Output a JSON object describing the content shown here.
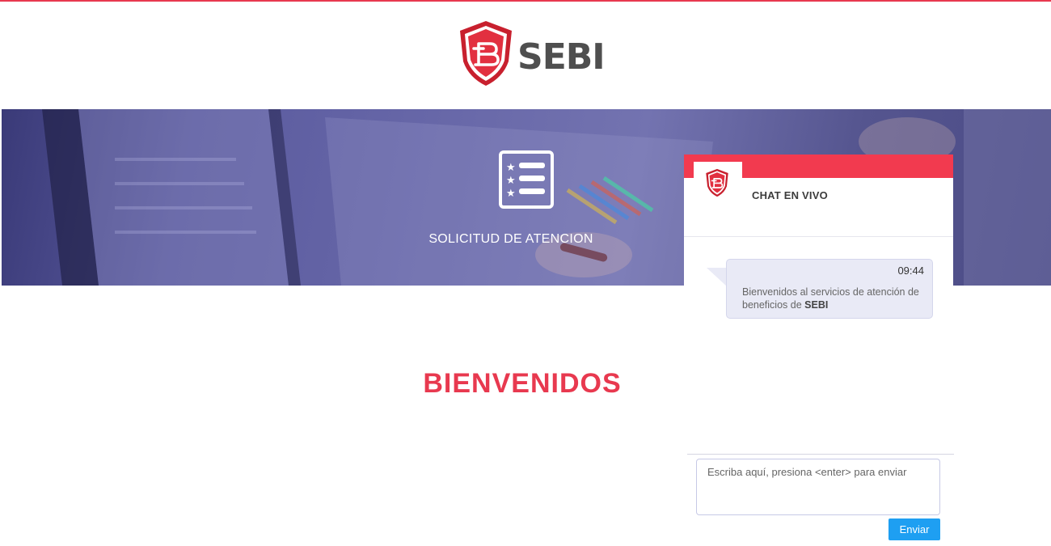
{
  "brand": {
    "name": "SEBI",
    "accent": "#e8394f"
  },
  "hero": {
    "title": "SOLICITUD DE ATENCION",
    "icon": "checklist-icon"
  },
  "main": {
    "title": "BIENVENIDOS"
  },
  "chat": {
    "title": "CHAT EN VIVO",
    "message": {
      "time": "09:44",
      "text": "Bienvenidos al servicios de atención de beneficios de ",
      "bold": "SEBI"
    },
    "input_placeholder": "Escriba aquí, presiona <enter> para enviar",
    "send_label": "Enviar",
    "bar_color": "#f23a4f",
    "button_color": "#1e9ff2"
  }
}
